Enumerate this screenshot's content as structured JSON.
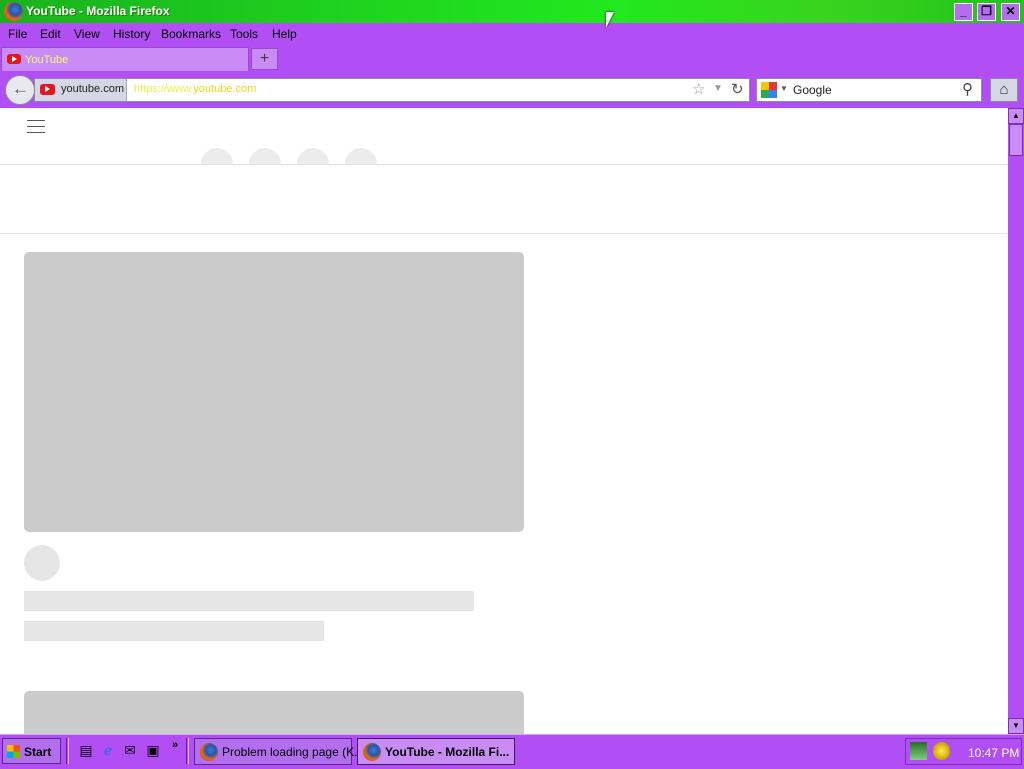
{
  "window": {
    "title": "YouTube - Mozilla Firefox"
  },
  "menu": {
    "items": [
      "File",
      "Edit",
      "View",
      "History",
      "Bookmarks",
      "Tools",
      "Help"
    ]
  },
  "tabs": [
    {
      "label": "YouTube"
    }
  ],
  "nav": {
    "site_identity": "youtube.com",
    "url_prefix": "https://www.",
    "url_host": "youtube.com",
    "search_engine": "Google"
  },
  "taskbar": {
    "start_label": "Start",
    "tasks": [
      {
        "label": "Problem loading page (K..."
      },
      {
        "label": "YouTube - Mozilla Fi..."
      }
    ],
    "clock": "10:47 PM"
  },
  "colors": {
    "accent": "#b14ff5",
    "titlebar_green": "#22e81f",
    "url_text": "#e4dd12",
    "skeleton_dark": "#cbcbcb",
    "skeleton_light": "#e6e6e6"
  },
  "icons": [
    "firefox-icon",
    "youtube-icon",
    "back-arrow-icon",
    "bookmark-star-icon",
    "dropdown-icon",
    "reload-icon",
    "google-icon",
    "search-icon",
    "home-icon",
    "hamburger-menu-icon",
    "windows-logo-icon"
  ]
}
